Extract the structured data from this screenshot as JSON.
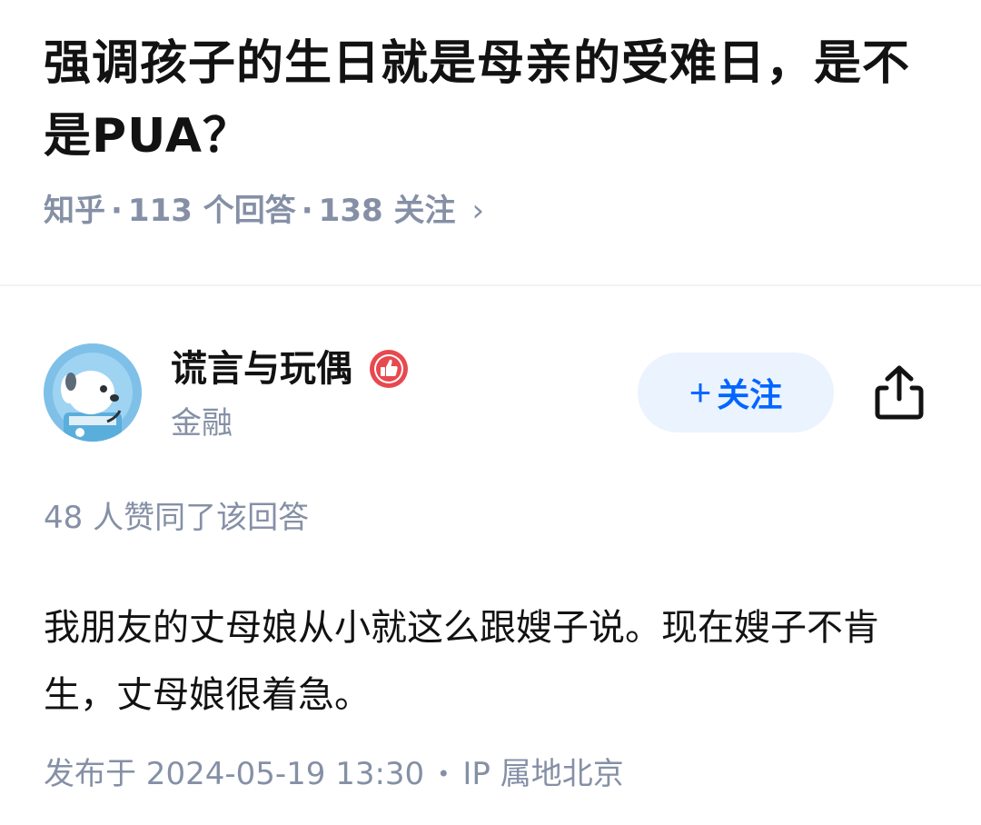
{
  "question": {
    "title": "强调孩子的生日就是母亲的受难日，是不是PUA？",
    "source": "知乎",
    "answers": "113 个回答",
    "followers": "138 关注",
    "chevron_icon": "chevron-right-icon"
  },
  "author": {
    "name": "谎言与玩偶",
    "tag": "金融",
    "avatar_icon": "dog-astronaut-avatar",
    "badge_icon": "thumbs-up-badge-icon",
    "follow_label": "关注",
    "follow_plus": "+",
    "share_icon": "share-icon"
  },
  "answer": {
    "votes": "48 人赞同了该回答",
    "content": "我朋友的丈母娘从小就这么跟嫂子说。现在嫂子不肯生，丈母娘很着急。",
    "published": "发布于 2024-05-19 13:30",
    "ip_location": "IP 属地北京"
  },
  "colors": {
    "accent": "#0066ff",
    "follow_bg": "#ebf3ff",
    "meta_gray": "#8590a6",
    "badge_red": "#e8484f"
  }
}
